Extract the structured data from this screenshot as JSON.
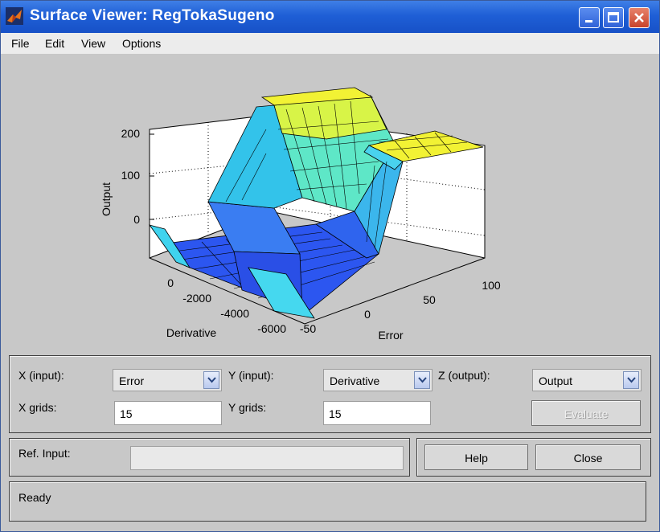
{
  "window": {
    "title": "Surface Viewer: RegTokaSugeno",
    "minimize_icon": "minimize-icon",
    "maximize_icon": "maximize-icon",
    "close_icon": "close-icon"
  },
  "menu": [
    "File",
    "Edit",
    "View",
    "Options"
  ],
  "plot": {
    "z_axis_label": "Output",
    "x_axis_label": "Error",
    "y_axis_label": "Derivative",
    "z_ticks": [
      "200",
      "100",
      "0"
    ],
    "x_ticks": [
      "100",
      "50",
      "0",
      "-50"
    ],
    "y_ticks": [
      "0",
      "-2000",
      "-4000",
      "-6000"
    ],
    "colors": {
      "low": "#1f4ae8",
      "mid": "#27c7e8",
      "high": "#f3f33a"
    }
  },
  "controls": {
    "x_input_label": "X (input):",
    "x_input_value": "Error",
    "y_input_label": "Y (input):",
    "y_input_value": "Derivative",
    "z_output_label": "Z (output):",
    "z_output_value": "Output",
    "x_grids_label": "X grids:",
    "x_grids_value": "15",
    "y_grids_label": "Y grids:",
    "y_grids_value": "15",
    "evaluate_label": "Evaluate",
    "ref_input_label": "Ref. Input:",
    "ref_input_value": "",
    "help_label": "Help",
    "close_label": "Close",
    "status": "Ready"
  }
}
